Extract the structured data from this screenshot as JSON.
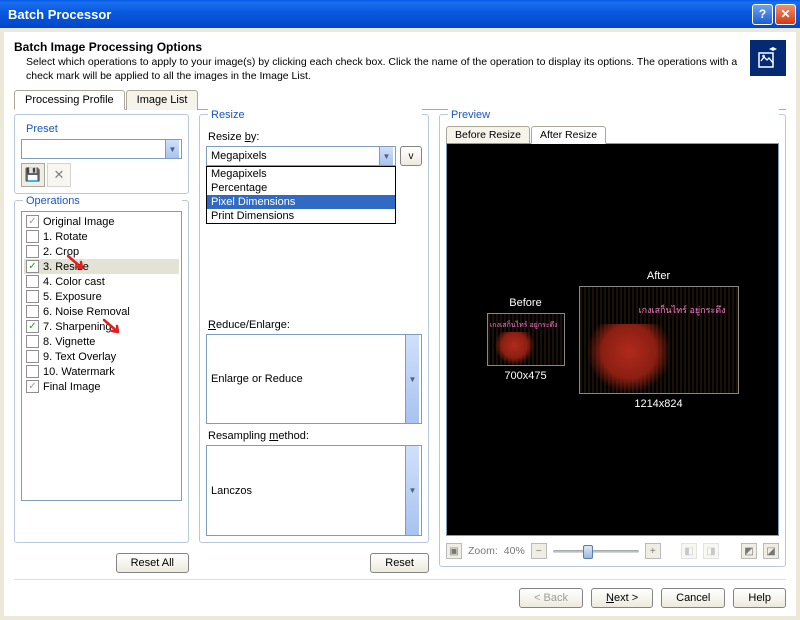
{
  "window": {
    "title": "Batch Processor"
  },
  "header": {
    "title": "Batch Image Processing Options",
    "desc": "Select which operations to apply to your image(s) by clicking each check box.  Click the name of the operation to display its options.  The operations with a check mark will be applied to all the images in the Image List."
  },
  "tabs": {
    "processing": "Processing Profile",
    "imagelist": "Image List"
  },
  "preset": {
    "title": "Preset",
    "save_icon": "💾",
    "delete_icon": "✕"
  },
  "operations": {
    "title": "Operations",
    "items": [
      {
        "label": "Original Image",
        "checked": true,
        "locked": true
      },
      {
        "label": "1. Rotate",
        "checked": false
      },
      {
        "label": "2. Crop",
        "checked": false
      },
      {
        "label": "3. Resize",
        "checked": true,
        "selected": true
      },
      {
        "label": "4. Color cast",
        "checked": false
      },
      {
        "label": "5. Exposure",
        "checked": false
      },
      {
        "label": "6. Noise Removal",
        "checked": false
      },
      {
        "label": "7. Sharpening",
        "checked": true
      },
      {
        "label": "8. Vignette",
        "checked": false
      },
      {
        "label": "9. Text Overlay",
        "checked": false
      },
      {
        "label": "10. Watermark",
        "checked": false
      },
      {
        "label": "Final Image",
        "checked": true,
        "locked": true
      }
    ],
    "reset_all": "Reset All"
  },
  "resize": {
    "title": "Resize",
    "by_label": "Resize by:",
    "by_underline": "b",
    "selected": "Megapixels",
    "options": [
      "Megapixels",
      "Percentage",
      "Pixel Dimensions",
      "Print Dimensions"
    ],
    "highlighted_index": 2,
    "aux_btn": "v",
    "reduce_label": "Reduce/Enlarge:",
    "reduce_underline": "R",
    "reduce_value": "Enlarge or Reduce",
    "resample_label": "Resampling method:",
    "resample_underline": "m",
    "resample_value": "Lanczos",
    "reset": "Reset"
  },
  "preview": {
    "title": "Preview",
    "tabs": {
      "before": "Before Resize",
      "after": "After Resize"
    },
    "before_label": "Before",
    "after_label": "After",
    "before_dim": "700x475",
    "after_dim": "1214x824",
    "overlay_text": "เกงเสก็นไทร์\nอยู่กระดึง",
    "zoom_label": "Zoom:",
    "zoom_value": "40%"
  },
  "footer": {
    "back": "< Back",
    "next": "Next >",
    "cancel": "Cancel",
    "help": "Help"
  }
}
